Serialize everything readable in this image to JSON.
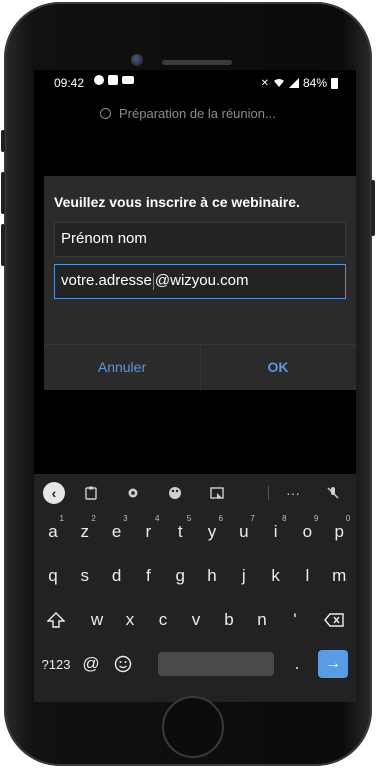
{
  "status_bar": {
    "time": "09:42",
    "battery": "84%",
    "left_icons": [
      "notification-icon",
      "mail-icon",
      "video-icon"
    ],
    "right_icons": [
      "mute-icon",
      "wifi-icon",
      "signal-icon",
      "battery-icon"
    ]
  },
  "loading_text": "Préparation de la réunion...",
  "dialog": {
    "title": "Veuillez vous inscrire à ce webinaire.",
    "name_value": "Prénom nom",
    "email_before_caret": "votre.adresse",
    "email_after_caret": "@wizyou.com",
    "cancel_label": "Annuler",
    "ok_label": "OK"
  },
  "keyboard": {
    "toolbar": [
      "back",
      "clipboard",
      "settings",
      "palette",
      "screen",
      "more",
      "mic-off"
    ],
    "row1": [
      {
        "key": "a",
        "num": "1"
      },
      {
        "key": "z",
        "num": "2"
      },
      {
        "key": "e",
        "num": "3"
      },
      {
        "key": "r",
        "num": "4"
      },
      {
        "key": "t",
        "num": "5"
      },
      {
        "key": "y",
        "num": "6"
      },
      {
        "key": "u",
        "num": "7"
      },
      {
        "key": "i",
        "num": "8"
      },
      {
        "key": "o",
        "num": "9"
      },
      {
        "key": "p",
        "num": "0"
      }
    ],
    "row2": [
      "q",
      "s",
      "d",
      "f",
      "g",
      "h",
      "j",
      "k",
      "l",
      "m"
    ],
    "row3": [
      "w",
      "x",
      "c",
      "v",
      "b",
      "n",
      "'"
    ],
    "row4": {
      "sym": "?123",
      "at": "@",
      "period": "."
    }
  },
  "colors": {
    "accent": "#5e95de",
    "dialog_bg": "#2b2b2b",
    "keyboard_bg": "#222222",
    "enter_key": "#5a9be6"
  }
}
